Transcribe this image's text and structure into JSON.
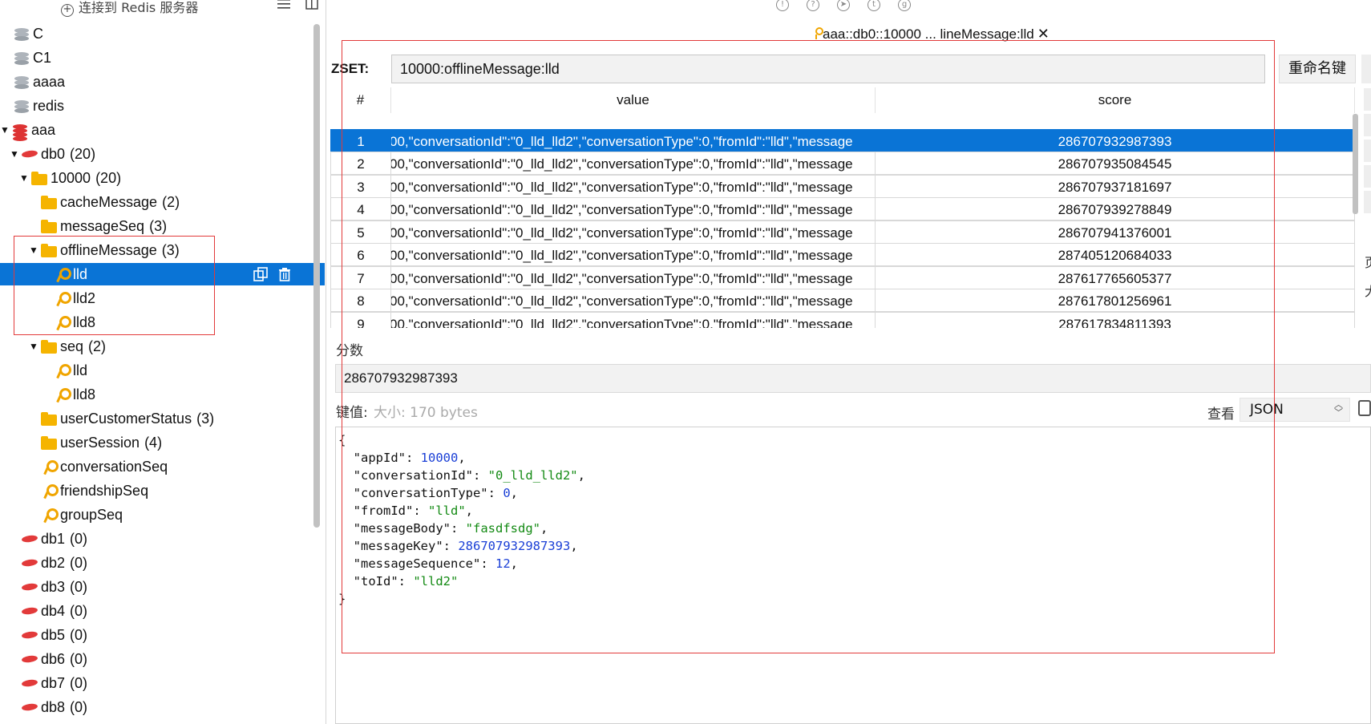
{
  "sidebar": {
    "connect_label": "连接到 Redis 服务器",
    "tree": [
      {
        "label": "C",
        "icon": "server-icon",
        "count": ""
      },
      {
        "label": "C1",
        "icon": "server-icon",
        "count": ""
      },
      {
        "label": "aaaa",
        "icon": "server-icon",
        "count": ""
      },
      {
        "label": "redis",
        "icon": "server-icon",
        "count": ""
      },
      {
        "label": "aaa",
        "icon": "server-red-icon",
        "count": ""
      },
      {
        "label": "db0",
        "icon": "database-icon",
        "count": "(20)"
      },
      {
        "label": "10000",
        "icon": "folder-icon",
        "count": "(20)"
      },
      {
        "label": "cacheMessage",
        "icon": "folder-icon",
        "count": "(2)"
      },
      {
        "label": "messageSeq",
        "icon": "folder-icon",
        "count": "(3)"
      },
      {
        "label": "offlineMessage",
        "icon": "folder-icon",
        "count": "(3)"
      },
      {
        "label": "lld",
        "icon": "key-icon",
        "count": ""
      },
      {
        "label": "lld2",
        "icon": "key-icon",
        "count": ""
      },
      {
        "label": "lld8",
        "icon": "key-icon",
        "count": ""
      },
      {
        "label": "seq",
        "icon": "folder-icon",
        "count": "(2)"
      },
      {
        "label": "lld",
        "icon": "key-icon",
        "count": ""
      },
      {
        "label": "lld8",
        "icon": "key-icon",
        "count": ""
      },
      {
        "label": "userCustomerStatus",
        "icon": "folder-icon",
        "count": "(3)"
      },
      {
        "label": "userSession",
        "icon": "folder-icon",
        "count": "(4)"
      },
      {
        "label": "conversationSeq",
        "icon": "key-icon",
        "count": ""
      },
      {
        "label": "friendshipSeq",
        "icon": "key-icon",
        "count": ""
      },
      {
        "label": "groupSeq",
        "icon": "key-icon",
        "count": ""
      },
      {
        "label": "db1",
        "icon": "database-icon",
        "count": "(0)"
      },
      {
        "label": "db2",
        "icon": "database-icon",
        "count": "(0)"
      },
      {
        "label": "db3",
        "icon": "database-icon",
        "count": "(0)"
      },
      {
        "label": "db4",
        "icon": "database-icon",
        "count": "(0)"
      },
      {
        "label": "db5",
        "icon": "database-icon",
        "count": "(0)"
      },
      {
        "label": "db6",
        "icon": "database-icon",
        "count": "(0)"
      },
      {
        "label": "db7",
        "icon": "database-icon",
        "count": "(0)"
      },
      {
        "label": "db8",
        "icon": "database-icon",
        "count": "(0)"
      }
    ]
  },
  "tab": {
    "title": "aaa::db0::10000 ... lineMessage:lld",
    "close": "✕"
  },
  "key": {
    "type_label": "ZSET:",
    "name": "10000:offlineMessage:lld",
    "rename_label": "重命名键"
  },
  "table": {
    "headers": [
      "#",
      "value",
      "score"
    ],
    "value_prefix": "00,\"conversationId\":\"0_lld_lld2\",\"conversationType\":0,\"fromId\":\"lld\",\"message",
    "rows": [
      {
        "num": "1",
        "score": "286707932987393"
      },
      {
        "num": "2",
        "score": "286707935084545"
      },
      {
        "num": "3",
        "score": "286707937181697"
      },
      {
        "num": "4",
        "score": "286707939278849"
      },
      {
        "num": "5",
        "score": "286707941376001"
      },
      {
        "num": "6",
        "score": "287405120684033"
      },
      {
        "num": "7",
        "score": "287617765605377"
      },
      {
        "num": "8",
        "score": "287617801256961"
      },
      {
        "num": "9",
        "score": "287617834811393"
      }
    ],
    "edge_chars": [
      "页",
      "大"
    ]
  },
  "score_label": "分数",
  "score_value": "286707932987393",
  "value_label": "键值:",
  "value_size": "大小: 170 bytes",
  "view_label": "查看",
  "view_format": "JSON",
  "json": {
    "open": "{",
    "close": "}",
    "entries": [
      {
        "key": "\"appId\"",
        "value": "10000",
        "kind": "number"
      },
      {
        "key": "\"conversationId\"",
        "value": "\"0_lld_lld2\"",
        "kind": "string"
      },
      {
        "key": "\"conversationType\"",
        "value": "0",
        "kind": "number"
      },
      {
        "key": "\"fromId\"",
        "value": "\"lld\"",
        "kind": "string"
      },
      {
        "key": "\"messageBody\"",
        "value": "\"fasdfsdg\"",
        "kind": "string"
      },
      {
        "key": "\"messageKey\"",
        "value": "286707932987393",
        "kind": "number"
      },
      {
        "key": "\"messageSequence\"",
        "value": "12",
        "kind": "number"
      },
      {
        "key": "\"toId\"",
        "value": "\"lld2\"",
        "kind": "string"
      }
    ]
  },
  "colors": {
    "selection": "#0a74d6",
    "annotation": "#e23a3a",
    "json_number": "#1a3fd6",
    "json_string": "#138a13"
  }
}
